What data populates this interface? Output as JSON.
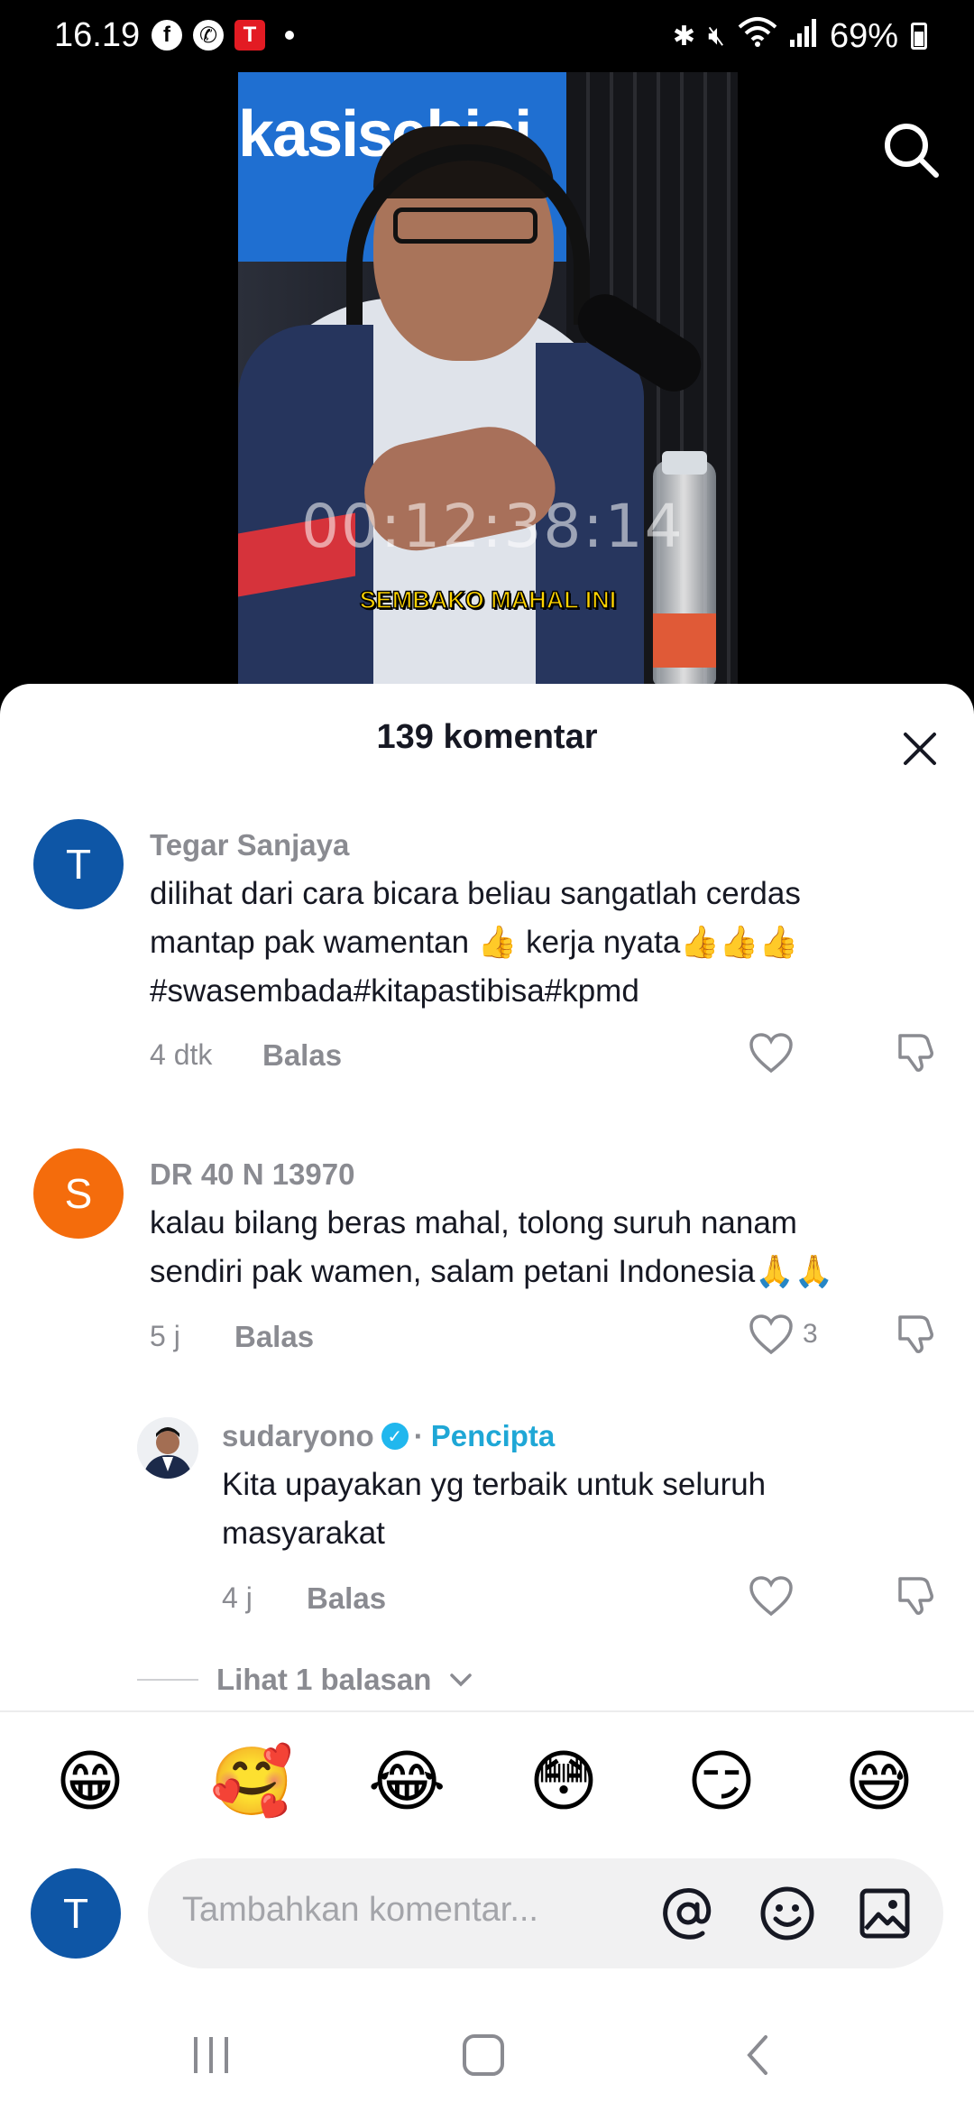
{
  "status_bar": {
    "time": "16.19",
    "battery": "69%",
    "left_icons": [
      "facebook-icon",
      "whatsapp-icon",
      "telkomsel-icon"
    ],
    "right_icons": [
      "bluetooth-icon",
      "mute-icon",
      "wifi-icon",
      "signal-icon",
      "battery-icon"
    ]
  },
  "video": {
    "banner_text": "kasisebisi",
    "timecode": "00:12:38:14",
    "caption": "SEMBAKO MAHAL INI"
  },
  "sheet": {
    "title": "139 komentar"
  },
  "comments": [
    {
      "avatar_letter": "T",
      "name": "Tegar Sanjaya",
      "text_lines": [
        "dilihat dari cara bicara beliau sangatlah cerdas",
        "mantap pak wamentan 👍 kerja nyata👍👍👍",
        "#swasembada#kitapastibisa#kpmd"
      ],
      "time": "4 dtk",
      "reply_label": "Balas",
      "likes": ""
    },
    {
      "avatar_letter": "S",
      "name": "DR 40 N 13970",
      "text_lines": [
        "kalau bilang beras mahal, tolong suruh nanam",
        "sendiri pak wamen, salam petani Indonesia🙏🙏"
      ],
      "time": "5 j",
      "reply_label": "Balas",
      "likes": "3"
    }
  ],
  "reply": {
    "name": "sudaryono",
    "separator": "·",
    "creator_label": "Pencipta",
    "text_lines": [
      "Kita upayakan yg terbaik untuk seluruh",
      "masyarakat"
    ],
    "time": "4 j",
    "reply_label": "Balas"
  },
  "view_replies": {
    "label": "Lihat 1 balasan"
  },
  "emoji_bar": [
    "😁",
    "🥰",
    "😂",
    "😳",
    "😏",
    "😅"
  ],
  "composer": {
    "avatar_letter": "T",
    "placeholder": "Tambahkan komentar..."
  },
  "colors": {
    "accent_creator": "#1fa7d6",
    "avatar_blue": "#0e56a6",
    "avatar_orange": "#f46c0c",
    "text_primary": "#161823",
    "text_secondary": "#8a8b91"
  }
}
